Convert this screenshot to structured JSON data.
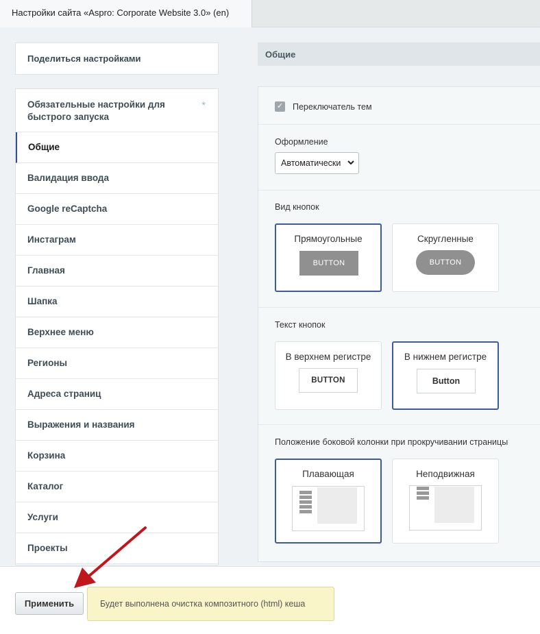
{
  "tab": {
    "title": "Настройки сайта «Aspro: Corporate Website 3.0» (en)"
  },
  "sidebar": {
    "share_label": "Поделиться настройками",
    "items": [
      {
        "label": "Обязательные настройки для быстрого запуска",
        "star": "*"
      },
      {
        "label": "Общие"
      },
      {
        "label": "Валидация ввода"
      },
      {
        "label": "Google reCaptcha"
      },
      {
        "label": "Инстаграм"
      },
      {
        "label": "Главная"
      },
      {
        "label": "Шапка"
      },
      {
        "label": "Верхнее меню"
      },
      {
        "label": "Регионы"
      },
      {
        "label": "Адреса страниц"
      },
      {
        "label": "Выражения и названия"
      },
      {
        "label": "Корзина"
      },
      {
        "label": "Каталог"
      },
      {
        "label": "Услуги"
      },
      {
        "label": "Проекты"
      }
    ],
    "active_index": 1
  },
  "main": {
    "section_title": "Общие",
    "theme_switcher": {
      "label": "Переключатель тем",
      "checked": true
    },
    "design": {
      "label": "Оформление",
      "selected": "Автоматически"
    },
    "button_type": {
      "label": "Вид кнопок",
      "options": [
        {
          "label": "Прямоугольные",
          "sample": "BUTTON",
          "selected": true
        },
        {
          "label": "Скругленные",
          "sample": "BUTTON",
          "selected": false
        }
      ]
    },
    "button_text": {
      "label": "Текст кнопок",
      "options": [
        {
          "label": "В верхнем регистре",
          "sample": "BUTTON",
          "selected": false
        },
        {
          "label": "В нижнем регистре",
          "sample": "Button",
          "selected": true
        }
      ]
    },
    "sidebar_position": {
      "label": "Положение боковой колонки при прокручивании страницы",
      "options": [
        {
          "label": "Плавающая",
          "selected": true
        },
        {
          "label": "Неподвижная",
          "selected": false
        }
      ]
    }
  },
  "footer": {
    "apply_label": "Применить",
    "note": "Будет выполнена очистка композитного (html) кеша"
  },
  "colors": {
    "accent": "#3d5a9e",
    "annotation_arrow": "#c0171c",
    "note_bg": "#f9f5c9"
  },
  "icons": {
    "checkbox": "check-icon",
    "select": "chevron-down-icon",
    "annotation": "red-arrow"
  }
}
